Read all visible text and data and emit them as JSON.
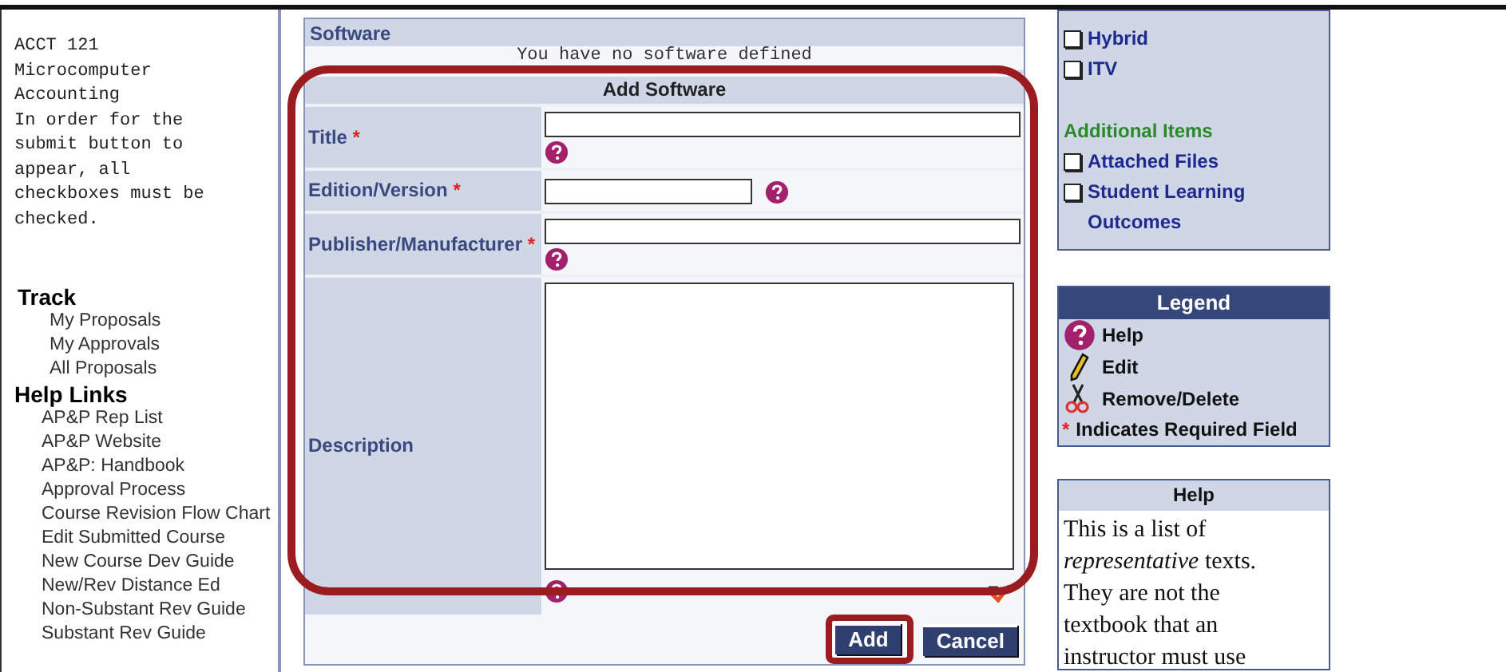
{
  "sidebar": {
    "course_info": [
      "ACCT 121",
      "Microcomputer",
      "Accounting",
      "In order for the",
      "submit button to",
      "appear, all",
      "checkboxes must be",
      "checked."
    ],
    "sections": [
      {
        "heading": "Track",
        "links": [
          "My Proposals",
          "My Approvals",
          "All Proposals"
        ]
      },
      {
        "heading": "Help Links",
        "links": [
          "AP&P Rep List",
          "AP&P Website",
          "AP&P: Handbook",
          "Approval Process",
          "Course Revision Flow Chart",
          "Edit Submitted Course",
          "New Course Dev Guide",
          "New/Rev Distance Ed",
          "Non-Substant Rev Guide",
          "Substant Rev Guide"
        ]
      }
    ]
  },
  "software": {
    "heading": "Software",
    "message": "You have no software defined",
    "form": {
      "title": "Add Software",
      "fields": [
        {
          "label": "Title",
          "required_mark": "*",
          "kind": "wide"
        },
        {
          "label": "Edition/Version",
          "required_mark": "*",
          "kind": "short"
        },
        {
          "label": "Publisher/Manufacturer",
          "required_mark": "*",
          "kind": "wide"
        },
        {
          "label": "Description",
          "kind": "textarea"
        }
      ],
      "buttons": [
        {
          "label": "Add",
          "highlighted": true
        },
        {
          "label": "Cancel",
          "highlighted": false
        }
      ]
    }
  },
  "checklist": {
    "groups": [
      {
        "items": [
          {
            "label": "Hybrid",
            "checked": false
          },
          {
            "label": "ITV",
            "checked": false
          }
        ]
      },
      {
        "heading": "Additional Items",
        "items": [
          {
            "label": "Attached Files",
            "checked": false
          },
          {
            "label": "Student Learning Outcomes",
            "checked": false
          }
        ]
      }
    ]
  },
  "legend": {
    "title": "Legend",
    "items": [
      {
        "kind": "help",
        "label": "Help"
      },
      {
        "kind": "edit",
        "label": "Edit"
      },
      {
        "kind": "delete",
        "label": "Remove/Delete"
      },
      {
        "kind": "required",
        "symbol": "*",
        "label": "Indicates Required Field"
      }
    ]
  },
  "help": {
    "title": "Help",
    "text": "This is a list of *representative* texts. They are not the textbook that an instructor must use"
  }
}
